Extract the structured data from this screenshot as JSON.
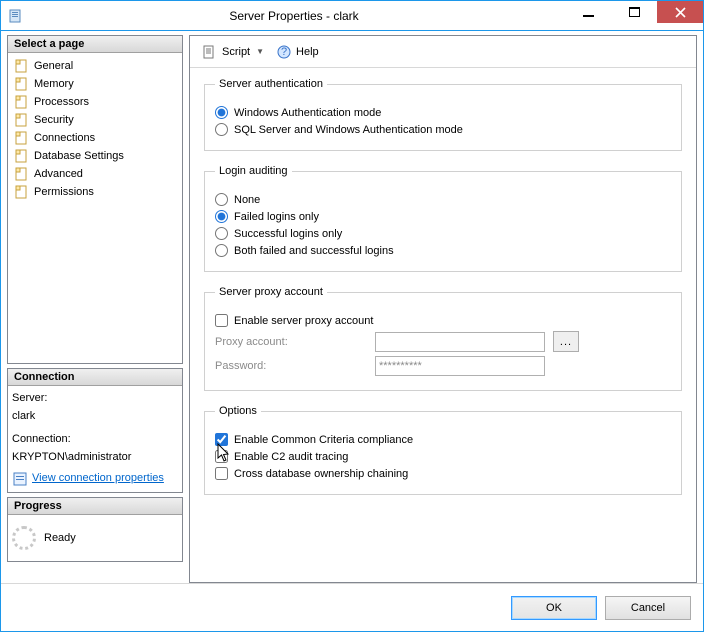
{
  "window": {
    "title": "Server Properties - clark"
  },
  "toolbar": {
    "script_label": "Script",
    "help_label": "Help"
  },
  "left": {
    "select_page_header": "Select a page",
    "connection_header": "Connection",
    "progress_header": "Progress",
    "ready_label": "Ready",
    "nav_items": [
      {
        "label": "General"
      },
      {
        "label": "Memory"
      },
      {
        "label": "Processors"
      },
      {
        "label": "Security"
      },
      {
        "label": "Connections"
      },
      {
        "label": "Database Settings"
      },
      {
        "label": "Advanced"
      },
      {
        "label": "Permissions"
      }
    ],
    "server_label": "Server:",
    "server_value": "clark",
    "connection_label": "Connection:",
    "connection_value": "KRYPTON\\administrator",
    "view_conn_props": "View connection properties"
  },
  "content": {
    "server_auth": {
      "legend": "Server authentication",
      "opt_windows": "Windows Authentication mode",
      "opt_mixed": "SQL Server and Windows Authentication mode"
    },
    "login_audit": {
      "legend": "Login auditing",
      "opt_none": "None",
      "opt_failed": "Failed logins only",
      "opt_success": "Successful logins only",
      "opt_both": "Both failed and successful logins"
    },
    "proxy": {
      "legend": "Server proxy account",
      "enable_label": "Enable server proxy account",
      "proxy_account_label": "Proxy account:",
      "password_label": "Password:",
      "password_placeholder": "**********",
      "browse_label": "..."
    },
    "options": {
      "legend": "Options",
      "ccc_label": "Enable Common Criteria compliance",
      "c2_label": "Enable C2 audit tracing",
      "cross_db_label": "Cross database ownership chaining"
    }
  },
  "buttons": {
    "ok": "OK",
    "cancel": "Cancel"
  }
}
